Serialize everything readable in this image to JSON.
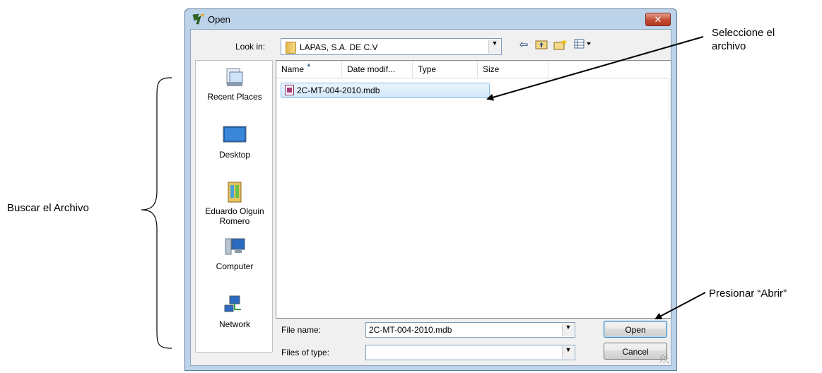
{
  "annotations": {
    "left": "Buscar el Archivo",
    "select_line1": "Seleccione el",
    "select_line2": "archivo",
    "open": "Presionar “Abrir”"
  },
  "dialog": {
    "title": "Open",
    "close_label": "✕",
    "look_in_label": "Look in:",
    "look_in_value": "LAPAS, S.A. DE C.V",
    "toolbar_icons": [
      "back-icon",
      "up-folder-icon",
      "new-folder-icon",
      "views-menu-icon"
    ]
  },
  "places": [
    {
      "label": "Recent Places"
    },
    {
      "label": "Desktop"
    },
    {
      "label": "Eduardo Olguin Romero"
    },
    {
      "label": "Computer"
    },
    {
      "label": "Network"
    }
  ],
  "columns": [
    "Name",
    "Date modif...",
    "Type",
    "Size"
  ],
  "files": [
    {
      "name": "2C-MT-004-2010.mdb",
      "selected": true
    }
  ],
  "file_name_label": "File name:",
  "file_name_value": "2C-MT-004-2010.mdb",
  "file_type_label": "Files of type:",
  "file_type_value": "",
  "buttons": {
    "open": "Open",
    "cancel": "Cancel"
  },
  "colors": {
    "frame": "#bcd3ea",
    "selection": "#d3e8fb",
    "close": "#c24b32"
  }
}
